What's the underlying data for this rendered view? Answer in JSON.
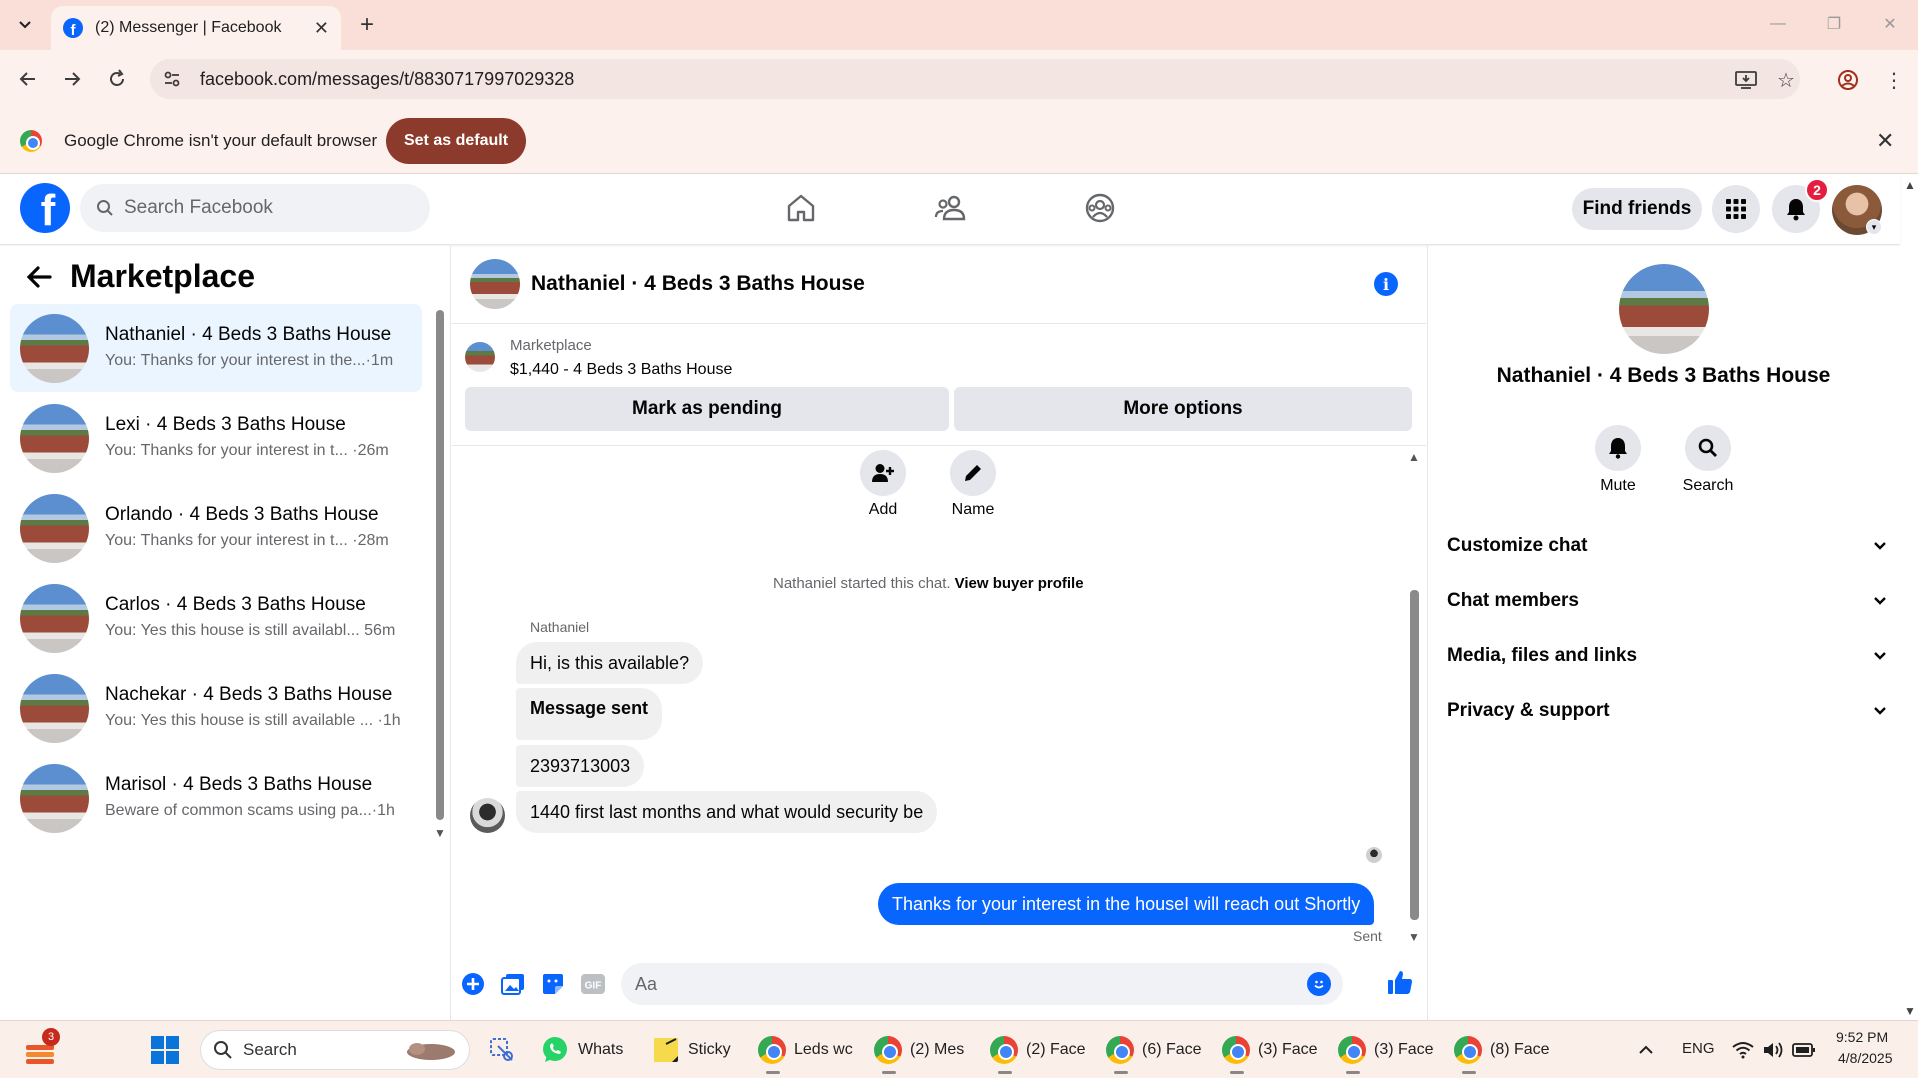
{
  "browser": {
    "tab_title": "(2) Messenger | Facebook",
    "url": "facebook.com/messages/t/8830717997029328",
    "infobar_text": "Google Chrome isn't your default browser",
    "infobar_button": "Set as default"
  },
  "fb_header": {
    "search_placeholder": "Search Facebook",
    "find_friends": "Find friends",
    "notification_count": "2"
  },
  "sidebar": {
    "title": "Marketplace",
    "conversations": [
      {
        "name": "Nathaniel · 4 Beds 3 Baths House",
        "preview": "You: Thanks for your interest in the...",
        "time": "·1m",
        "active": true
      },
      {
        "name": "Lexi · 4 Beds 3 Baths House",
        "preview": "You: Thanks for your interest in t...",
        "time": "·26m",
        "active": false
      },
      {
        "name": "Orlando · 4 Beds 3 Baths House",
        "preview": "You: Thanks for your interest in t...",
        "time": "·28m",
        "active": false
      },
      {
        "name": "Carlos · 4 Beds 3 Baths House",
        "preview": "You: Yes this house is still availabl...",
        "time": "56m",
        "active": false
      },
      {
        "name": "Nachekar · 4 Beds 3 Baths House",
        "preview": "You: Yes this house is still available ...",
        "time": "·1h",
        "active": false
      },
      {
        "name": "Marisol · 4 Beds 3 Baths House",
        "preview": "Beware of common scams using pa...",
        "time": "·1h",
        "active": false
      }
    ]
  },
  "chat": {
    "title": "Nathaniel · 4 Beds 3 Baths House",
    "listing_label": "Marketplace",
    "listing_price": "$1,440 - 4 Beds 3 Baths House",
    "mark_pending": "Mark as pending",
    "more_options": "More options",
    "actions": {
      "add": "Add",
      "name": "Name"
    },
    "started_text": "Nathaniel started this chat.",
    "view_buyer": "View buyer profile",
    "sender_name": "Nathaniel",
    "messages_in": [
      "Hi, is this available?",
      "Message sent",
      "2393713003",
      "1440 first last months and what would security be"
    ],
    "message_out": "Thanks for your interest in the houseI will reach out Shortly",
    "sent_label": "Sent",
    "composer_placeholder": "Aa"
  },
  "right_panel": {
    "name": "Nathaniel · 4 Beds 3 Baths House",
    "mute": "Mute",
    "search": "Search",
    "sections": [
      "Customize chat",
      "Chat members",
      "Media, files and links",
      "Privacy & support"
    ]
  },
  "taskbar": {
    "widget_badge": "3",
    "search": "Search",
    "apps": [
      {
        "label": "Whats"
      },
      {
        "label": "Sticky"
      },
      {
        "label": "Leds wc"
      },
      {
        "label": "(2) Mes"
      },
      {
        "label": "(2) Face"
      },
      {
        "label": "(6) Face"
      },
      {
        "label": "(3) Face"
      },
      {
        "label": "(3) Face"
      },
      {
        "label": "(8) Face"
      }
    ],
    "lang": "ENG",
    "time": "9:52 PM",
    "date": "4/8/2025"
  },
  "colors": {
    "fb_blue": "#0866ff",
    "chrome_button": "#8c3a2b",
    "active_conv_bg": "#ebf5ff"
  }
}
